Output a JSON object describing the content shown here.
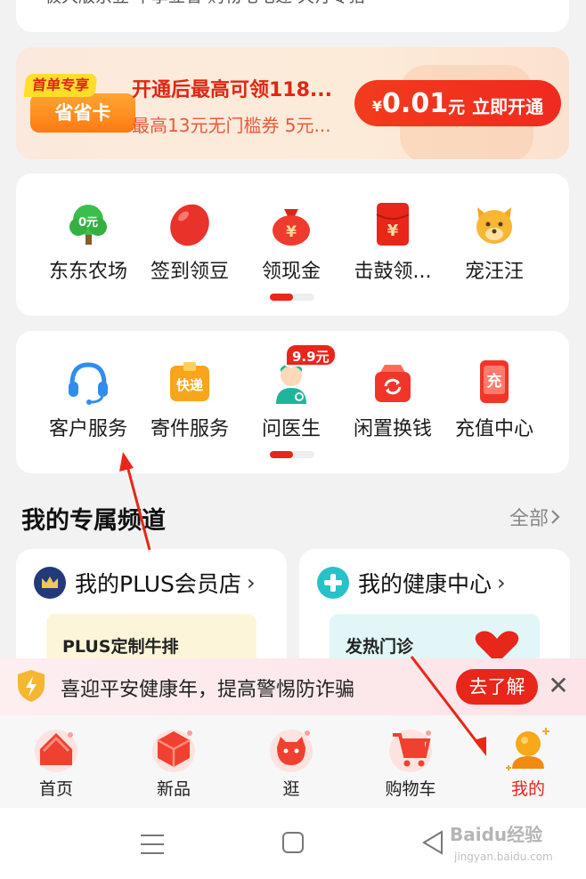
{
  "top_card": {
    "text": "极大版京豆  午享立省  购物宅宅递  天汀专猎"
  },
  "promo": {
    "badge_top": "首单专享",
    "badge_main": "省省卡",
    "title": "开通后最高可领118...",
    "subtitle": "最高13元无门槛券 5元...",
    "btn_currency": "¥",
    "btn_amount": "0.01",
    "btn_unit": "元",
    "btn_action": "立即开通"
  },
  "grid1": {
    "items": [
      {
        "label": "东东农场",
        "icon": "tree-icon"
      },
      {
        "label": "签到领豆",
        "icon": "bean-icon"
      },
      {
        "label": "领现金",
        "icon": "money-bag-icon"
      },
      {
        "label": "击鼓领...",
        "icon": "red-envelope-icon"
      },
      {
        "label": "宠汪汪",
        "icon": "dog-icon"
      }
    ]
  },
  "grid2": {
    "items": [
      {
        "label": "客户服务",
        "icon": "headset-icon"
      },
      {
        "label": "寄件服务",
        "icon": "express-box-icon",
        "icon_text": "快递"
      },
      {
        "label": "问医生",
        "icon": "doctor-icon",
        "badge": "9.9元"
      },
      {
        "label": "闲置换钱",
        "icon": "recycle-icon"
      },
      {
        "label": "充值中心",
        "icon": "phone-recharge-icon",
        "icon_text": "充"
      }
    ]
  },
  "section": {
    "title": "我的专属频道",
    "all_label": "全部"
  },
  "channels": [
    {
      "title": "我的PLUS会员店",
      "inner_text": "PLUS定制牛排",
      "icon": "crown-icon"
    },
    {
      "title": "我的健康中心",
      "inner_text": "发热门诊",
      "icon": "health-cross-icon"
    }
  ],
  "notice": {
    "text": "喜迎平安健康年，提高警惕防诈骗",
    "button": "去了解",
    "close": "✕"
  },
  "tabbar": {
    "tabs": [
      {
        "label": "首页",
        "icon": "home-icon",
        "active": false
      },
      {
        "label": "新品",
        "icon": "new-products-icon",
        "active": false
      },
      {
        "label": "逛",
        "icon": "browse-icon",
        "active": false
      },
      {
        "label": "购物车",
        "icon": "cart-icon",
        "active": false
      },
      {
        "label": "我的",
        "icon": "profile-icon",
        "active": true
      }
    ]
  },
  "watermark": {
    "text": "Baidu经验",
    "sub": "jingyan.baidu.com"
  },
  "colors": {
    "accent": "#e8261a",
    "promo_orange": "#ff7a12",
    "background": "#f2f2f2"
  }
}
